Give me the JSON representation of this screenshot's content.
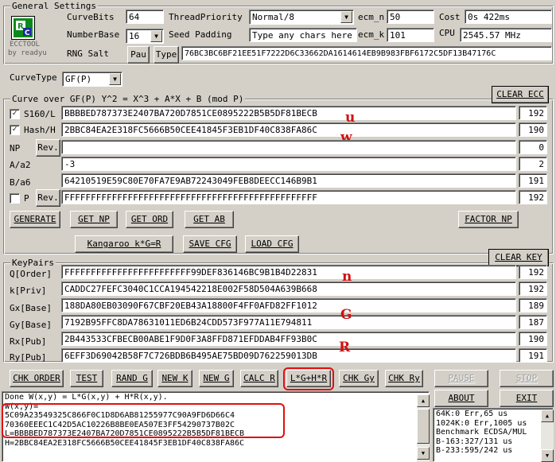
{
  "general": {
    "title": "General Settings",
    "logo_caption": "ECCTOOL",
    "logo_sub": "by readyu",
    "curvebits_label": "CurveBits",
    "curvebits_value": "64",
    "numberbase_label": "NumberBase",
    "numberbase_value": "16",
    "rng_label": "RNG Salt",
    "pau_label": "Pau",
    "type_label": "Type",
    "rng_value": "76BC3BC6BF21EE51F7222D6C33662DA1614614EB9B983FBF6172C5DF13B47176C",
    "threadpriority_label": "ThreadPriority",
    "threadpriority_value": "Normal/8",
    "seedpadding_label": "Seed Padding",
    "seedpadding_value": "Type any chars here",
    "ecm_n_label": "ecm_n",
    "ecm_n_value": "50",
    "ecm_k_label": "ecm_k",
    "ecm_k_value": "101",
    "cost_label": "Cost",
    "cost_value": "0s 422ms",
    "cpu_label": "CPU",
    "cpu_value": "2545.57 MHz"
  },
  "curvetype": {
    "label": "CurveType",
    "value": "GF(P)"
  },
  "curve": {
    "title": "Curve over GF(P) Y^2 = X^3 + A*X + B (mod P)",
    "clear_label": "CLEAR ECC",
    "s160_label": "S160/L",
    "s160_checked": true,
    "s160_value": "BBBBED787373E2407BA720D7851CE0895222B5B5DF81BECB",
    "s160_len": "192",
    "hash_label": "Hash/H",
    "hash_checked": true,
    "hash_value": "2BBC84EA2E318FC5666B50CEE41845F3EB1DF40C838FA86C",
    "hash_len": "190",
    "np_label": "NP",
    "np_btn": "Rev.",
    "np_value": "",
    "np_len": "0",
    "a_label": "A/a2",
    "a_value": "-3",
    "a_len": "2",
    "b_label": "B/a6",
    "b_value": "64210519E59C80E70FA7E9AB72243049FEB8DEECC146B9B1",
    "b_len": "191",
    "p_label": "P",
    "p_checked": false,
    "p_btn": "Rev.",
    "p_value": "FFFFFFFFFFFFFFFFFFFFFFFFFFFFFFFFFFFFFFFFFFFFFFFF",
    "p_len": "192",
    "annot_u": "u",
    "annot_w": "w"
  },
  "curve_buttons": {
    "generate": "GENERATE",
    "get_np": "GET NP",
    "get_ord": "GET ORD",
    "get_ab": "GET AB",
    "factor_np": "FACTOR NP",
    "kangaroo": "Kangaroo k*G=R",
    "save_cfg": "SAVE CFG",
    "load_cfg": "LOAD CFG"
  },
  "keypairs": {
    "title": "KeyPairs",
    "clear_label": "CLEAR KEY",
    "rows": [
      {
        "label": "Q[Order]",
        "value": "FFFFFFFFFFFFFFFFFFFFFFFF99DEF836146BC9B1B4D22831",
        "len": "192"
      },
      {
        "label": "k[Priv]",
        "value": "CADDC27FEFC3040C1CCA194542218E002F58D504A639B668",
        "len": "192"
      },
      {
        "label": "Gx[Base]",
        "value": "188DA80EB03090F67CBF20EB43A18800F4FF0AFD82FF1012",
        "len": "189"
      },
      {
        "label": "Gy[Base]",
        "value": "7192B95FFC8DA78631011ED6B24CDD573F977A11E794811",
        "len": "187"
      },
      {
        "label": "Rx[Pub]",
        "value": "2B443533CFBECB00ABE1F9D0F3A8FFD871EFDDAB4FF93B0C",
        "len": "190"
      },
      {
        "label": "Ry[Pub]",
        "value": "6EFF3D69042B58F7C726BDB6B495AE75BD09D762259013DB",
        "len": "191"
      }
    ],
    "annot_n": "n",
    "annot_g": "G",
    "annot_r": "R"
  },
  "key_buttons": {
    "chk_order": "CHK ORDER",
    "test": "TEST",
    "rand_g": "RAND G",
    "new_k": "NEW K",
    "new_g": "NEW G",
    "calc_r": "CALC R",
    "lghr": "L*G+H*R",
    "chk_gy": "CHK Gy",
    "chk_ry": "CHK Ry",
    "pause": "PAUSE",
    "stop": "STOP",
    "about": "ABOUT",
    "exit": "EXIT"
  },
  "output_lines": [
    "Done W(x,y) = L*G(x,y) + H*R(x,y).",
    "W(x,y)=",
    "5C09A23549325C866F0C1D8D6AB81255977C90A9FD6D66C4",
    "70360EEEC1C42D5AC10226B8BE0EA507E3FF54290737B02C",
    "L=BBBBED787373E2407BA720D7851CE0895222B5B5DF81BECB",
    "H=2BBC84EA2E318FC5666B50CEE41845F3EB1DF40C838FA86C"
  ],
  "bench_lines": [
    "64K:0 Err,65 us",
    "1024K:0 Err,1005 us",
    "Benchmark ECDSA/MUL",
    "B-163:327/131 us",
    "B-233:595/242 us"
  ],
  "colors": {
    "window_bg": "#d4d0c8",
    "annotation_red": "#d01010",
    "logo_green": "#0a8a1a",
    "logo_blue": "#1a2aa8"
  }
}
